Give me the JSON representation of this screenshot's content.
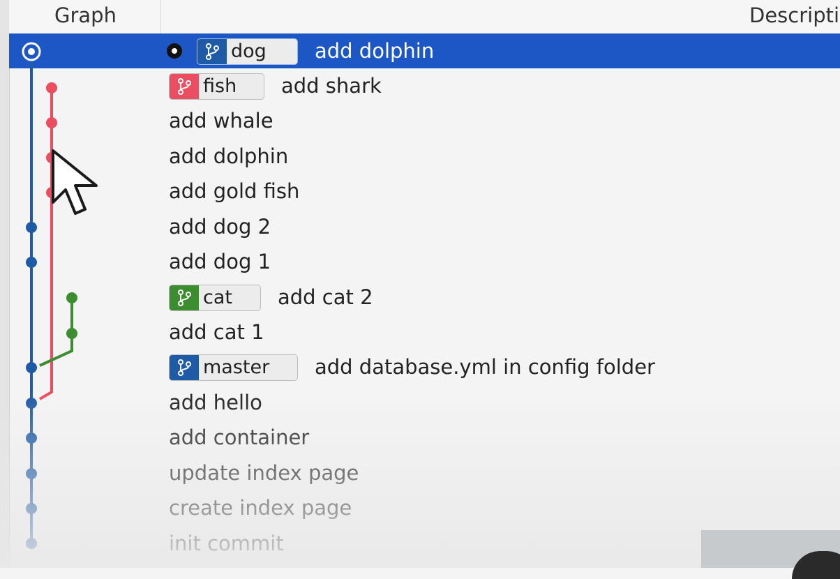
{
  "header": {
    "graph_label": "Graph",
    "description_label": "Descripti"
  },
  "colors": {
    "selected_bg": "#1d57c6",
    "blue": "#1f5aa6",
    "red": "#ea4e60",
    "green": "#3c8d2f"
  },
  "rows": [
    {
      "branch": "dog",
      "branch_color": "#1f5aa6",
      "message": "add dolphin",
      "selected": true,
      "head": true
    },
    {
      "branch": "fish",
      "branch_color": "#ea4e60",
      "message": "add shark"
    },
    {
      "message": "add whale"
    },
    {
      "message": "add dolphin"
    },
    {
      "message": "add gold fish"
    },
    {
      "message": "add dog 2"
    },
    {
      "message": "add dog 1"
    },
    {
      "branch": "cat",
      "branch_color": "#3c8d2f",
      "message": "add cat 2"
    },
    {
      "message": "add cat 1"
    },
    {
      "branch": "master",
      "branch_color": "#1f5aa6",
      "message": "add database.yml in config folder"
    },
    {
      "message": "add hello"
    },
    {
      "message": "add container"
    },
    {
      "message": "update index page"
    },
    {
      "message": "create index page"
    },
    {
      "message": "init commit"
    }
  ],
  "icons": {
    "branch": "git-branch-icon",
    "head": "current-head-icon",
    "cursor": "mouse-cursor-icon"
  }
}
